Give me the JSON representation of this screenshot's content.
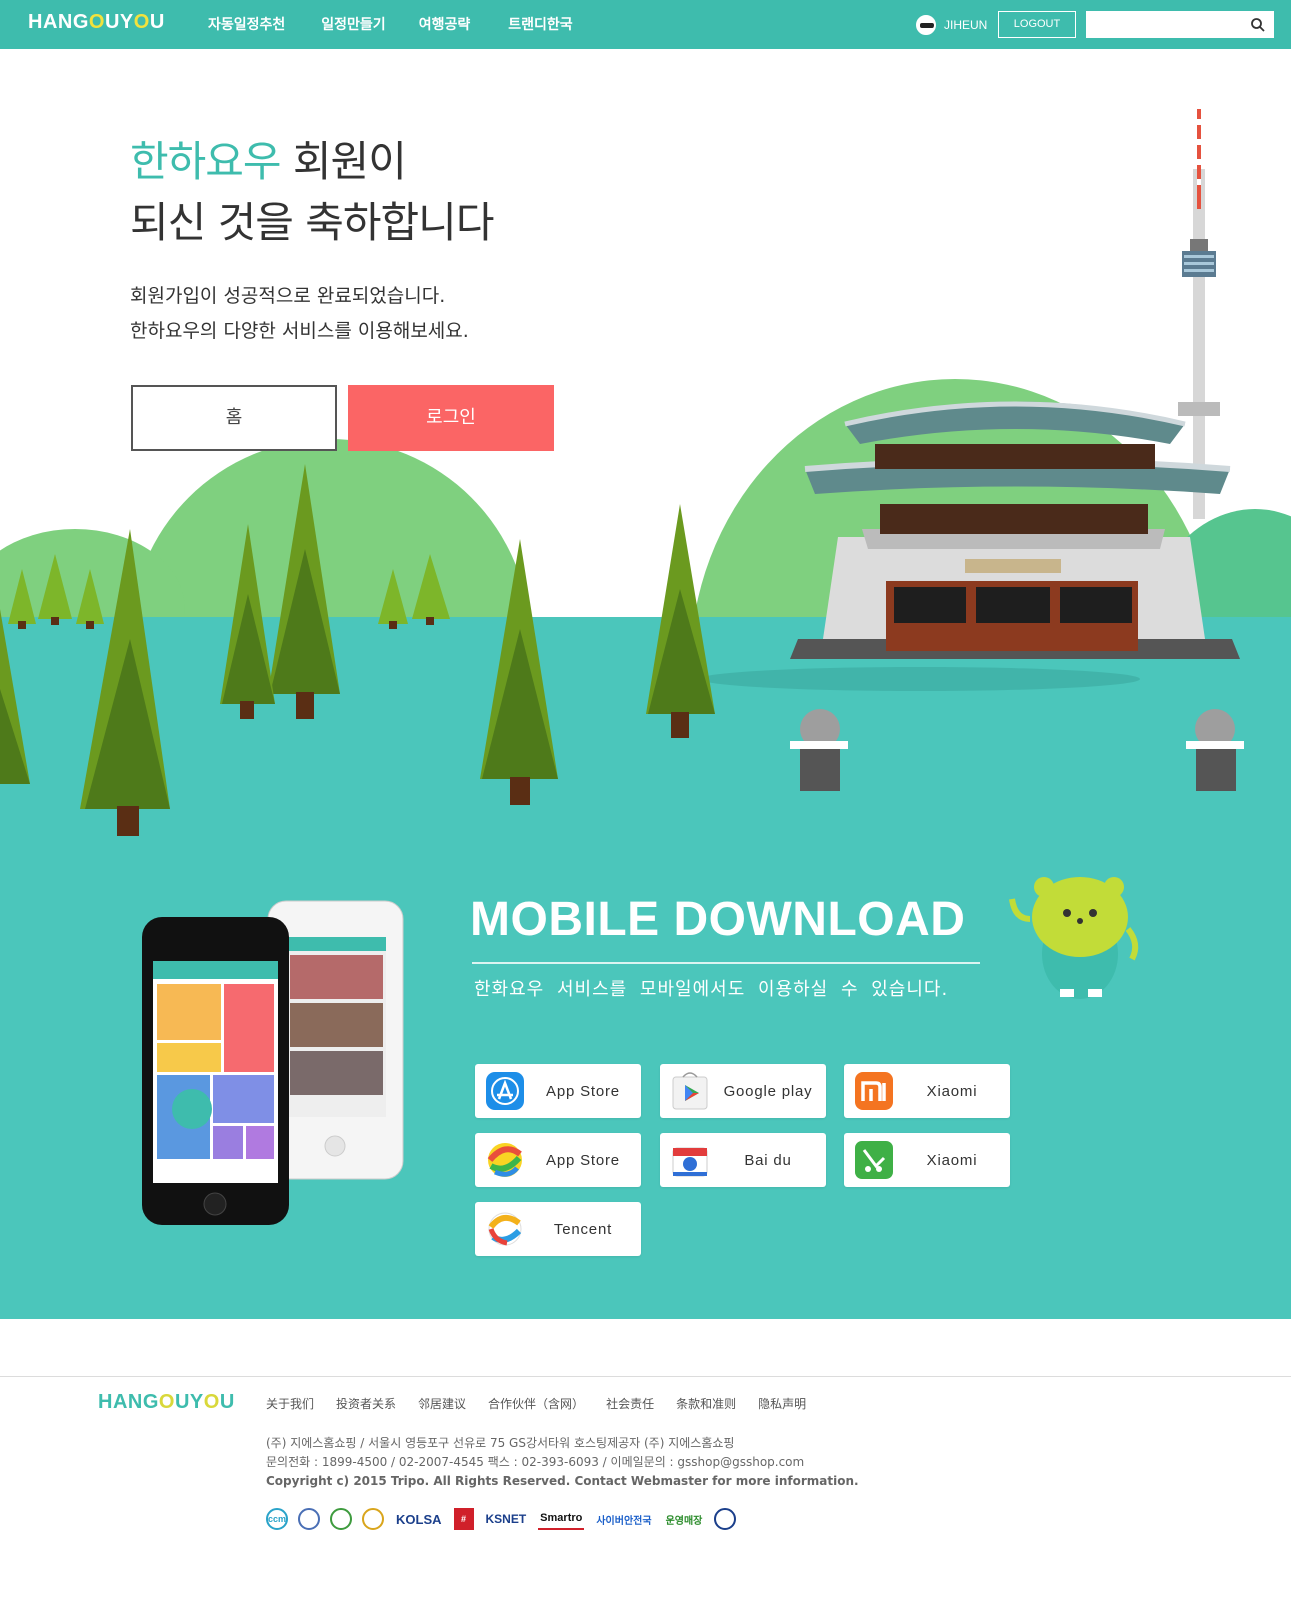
{
  "header": {
    "logo": {
      "pre": "HANG",
      "o1": "O",
      "mid": "UY",
      "o2": "O",
      "post": "U"
    },
    "nav": [
      "자동일정추천",
      "일정만들기",
      "여행공략",
      "트랜디한국"
    ],
    "username": "JIHEUN",
    "logout_label": "LOGOUT",
    "search_placeholder": "",
    "colors": {
      "bar": "#3ebcad",
      "logo_o": "#f2e23c"
    }
  },
  "hero": {
    "headline_accent": "한하요우",
    "headline_rest": " 회원이",
    "headline_line2": "되신 것을 축하합니다",
    "desc_line1": "회원가입이 성공적으로 완료되었습니다.",
    "desc_line2": "한하요우의 다양한 서비스를 이용해보세요.",
    "home_button": "홈",
    "login_button": "로그인",
    "colors": {
      "accent": "#3ebcad",
      "login": "#fb6565",
      "ground": "#4bc6bb",
      "hill": "#7fd07f"
    }
  },
  "mobile": {
    "title": "MOBILE DOWNLOAD",
    "subtitle": "한화요우 서비스를 모바일에서도 이용하실 수 있습니다.",
    "stores": [
      {
        "label": "App Store",
        "icon": "app-store-icon"
      },
      {
        "label": "Google play",
        "icon": "google-play-icon"
      },
      {
        "label": "Xiaomi",
        "icon": "xiaomi-icon"
      },
      {
        "label": "App Store",
        "icon": "360-store-icon"
      },
      {
        "label": "Bai du",
        "icon": "baidu-icon"
      },
      {
        "label": "Xiaomi",
        "icon": "wandoujia-icon"
      },
      {
        "label": "Tencent",
        "icon": "tencent-icon"
      }
    ]
  },
  "footer": {
    "logo": {
      "pre": "HANG",
      "o1": "O",
      "mid": "UY",
      "o2": "O",
      "post": "U"
    },
    "links": [
      "关于我们",
      "投资者关系",
      "邻居建议",
      "合作伙伴（含网）",
      "社会责任",
      "条款和准则",
      "隐私声明"
    ],
    "info_line1": "(주) 지에스홈쇼핑  / 서울시 영등포구 선유로 75 GS강서타워 호스팅제공자 (주) 지에스홈쇼핑",
    "info_line2": "문의전화 : 1899-4500 / 02-2007-4545 팩스 : 02-393-6093 / 이메일문의 : gsshop@gsshop.com",
    "info_line3": "Copyright c) 2015 Tripo. All Rights Reserved. Contact Webmaster for more information.",
    "certs": {
      "kolsa": "KOLSA",
      "ksnet": "KSNET",
      "smartro": "Smartro",
      "cyber": "사이버안전국",
      "store": "운영매장"
    }
  }
}
